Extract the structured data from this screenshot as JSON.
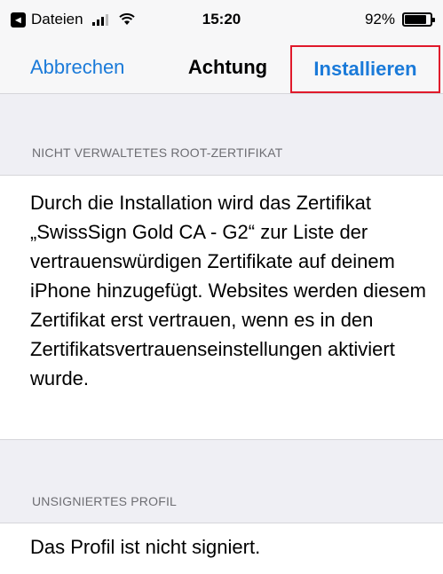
{
  "status_bar": {
    "back_app": "Dateien",
    "back_icon": "◂",
    "time": "15:20",
    "battery_percent_label": "92%",
    "battery_level": 0.92
  },
  "nav": {
    "cancel_label": "Abbrechen",
    "title": "Achtung",
    "install_label": "Installieren",
    "accent_color": "#1a7ad9",
    "highlight_color": "#e0192b"
  },
  "sections": {
    "root_cert": {
      "header": "NICHT VERWALTETES ROOT-ZERTIFIKAT",
      "text": "Durch die Installation wird das Zertifikat „SwissSign Gold CA - G2“ zur Liste der vertrauenswürdigen Zertifikate auf deinem iPhone hinzugefügt. Websites werden diesem Zertifikat erst vertrauen, wenn es in den Zertifikatsvertrauenseinstellungen aktiviert wurde."
    },
    "unsigned_profile": {
      "header": "UNSIGNIERTES PROFIL",
      "text": "Das Profil ist nicht signiert."
    }
  }
}
